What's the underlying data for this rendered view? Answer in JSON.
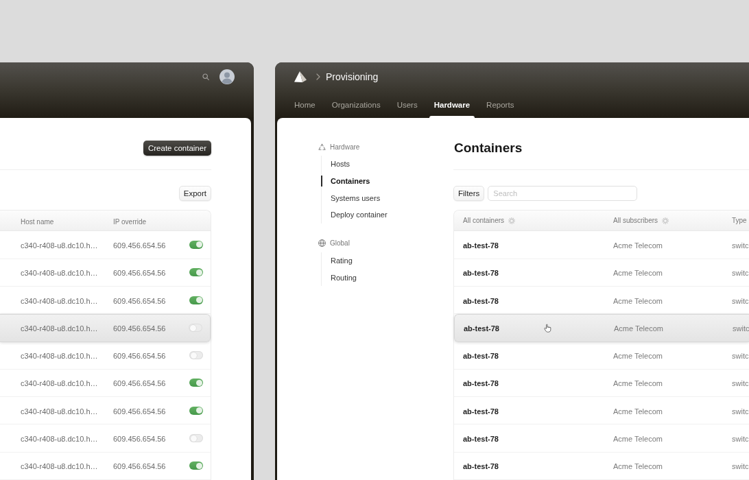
{
  "left_window": {
    "create_button": "Create container",
    "export_button": "Export",
    "table": {
      "columns": [
        "Host name",
        "IP override"
      ],
      "rows": [
        {
          "host_name": "c340-r408-u8.dc10.h…",
          "ip_override": "609.456.654.56",
          "enabled": true,
          "highlighted": false
        },
        {
          "host_name": "c340-r408-u8.dc10.h…",
          "ip_override": "609.456.654.56",
          "enabled": true,
          "highlighted": false
        },
        {
          "host_name": "c340-r408-u8.dc10.h…",
          "ip_override": "609.456.654.56",
          "enabled": true,
          "highlighted": false
        },
        {
          "host_name": "c340-r408-u8.dc10.h…",
          "ip_override": "609.456.654.56",
          "enabled": false,
          "highlighted": true
        },
        {
          "host_name": "c340-r408-u8.dc10.h…",
          "ip_override": "609.456.654.56",
          "enabled": false,
          "highlighted": false
        },
        {
          "host_name": "c340-r408-u8.dc10.h…",
          "ip_override": "609.456.654.56",
          "enabled": true,
          "highlighted": false
        },
        {
          "host_name": "c340-r408-u8.dc10.h…",
          "ip_override": "609.456.654.56",
          "enabled": true,
          "highlighted": false
        },
        {
          "host_name": "c340-r408-u8.dc10.h…",
          "ip_override": "609.456.654.56",
          "enabled": false,
          "highlighted": false
        },
        {
          "host_name": "c340-r408-u8.dc10.h…",
          "ip_override": "609.456.654.56",
          "enabled": true,
          "highlighted": false
        }
      ]
    }
  },
  "right_window": {
    "breadcrumb": "Provisioning",
    "tabs": [
      {
        "label": "Home",
        "selected": false
      },
      {
        "label": "Organizations",
        "selected": false
      },
      {
        "label": "Users",
        "selected": false
      },
      {
        "label": "Hardware",
        "selected": true
      },
      {
        "label": "Reports",
        "selected": false
      }
    ],
    "sidebar": {
      "groups": [
        {
          "label": "Hardware",
          "items": [
            {
              "label": "Hosts",
              "selected": false
            },
            {
              "label": "Containers",
              "selected": true
            },
            {
              "label": "Systems users",
              "selected": false
            },
            {
              "label": "Deploy container",
              "selected": false
            }
          ]
        },
        {
          "label": "Global",
          "items": [
            {
              "label": "Rating",
              "selected": false
            },
            {
              "label": "Routing",
              "selected": false
            }
          ]
        }
      ]
    },
    "title": "Containers",
    "filters_button": "Filters",
    "search": {
      "placeholder": "Search"
    },
    "table": {
      "columns": [
        {
          "label": "All containers",
          "settings": true
        },
        {
          "label": "All subscribers",
          "settings": true
        },
        {
          "label": "Type",
          "settings": false
        }
      ],
      "rows": [
        {
          "container": "ab-test-78",
          "subscriber": "Acme Telecom",
          "type": "switc",
          "highlighted": false
        },
        {
          "container": "ab-test-78",
          "subscriber": "Acme Telecom",
          "type": "switc",
          "highlighted": false
        },
        {
          "container": "ab-test-78",
          "subscriber": "Acme Telecom",
          "type": "switc",
          "highlighted": false
        },
        {
          "container": "ab-test-78",
          "subscriber": "Acme Telecom",
          "type": "switc",
          "highlighted": true
        },
        {
          "container": "ab-test-78",
          "subscriber": "Acme Telecom",
          "type": "switc",
          "highlighted": false
        },
        {
          "container": "ab-test-78",
          "subscriber": "Acme Telecom",
          "type": "switc",
          "highlighted": false
        },
        {
          "container": "ab-test-78",
          "subscriber": "Acme Telecom",
          "type": "switc",
          "highlighted": false
        },
        {
          "container": "ab-test-78",
          "subscriber": "Acme Telecom",
          "type": "switc",
          "highlighted": false
        },
        {
          "container": "ab-test-78",
          "subscriber": "Acme Telecom",
          "type": "switc",
          "highlighted": false
        }
      ]
    }
  }
}
